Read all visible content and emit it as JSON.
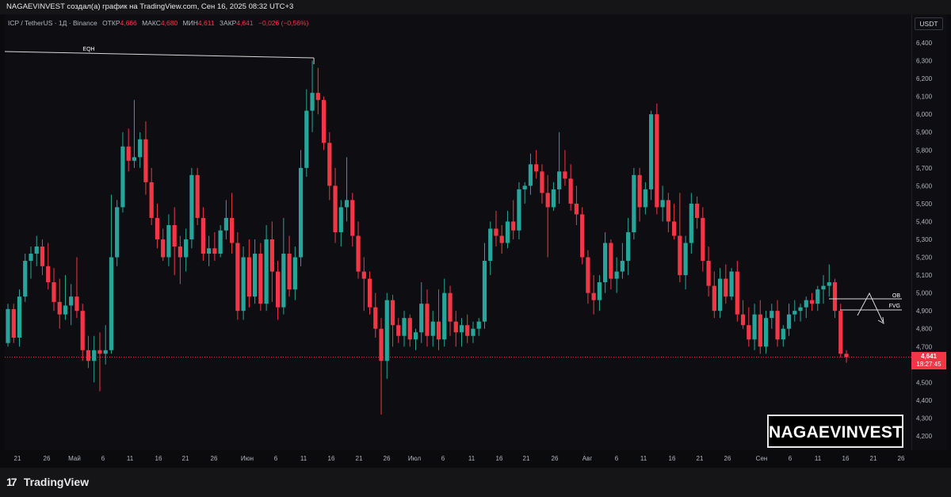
{
  "header": {
    "attribution": "NAGAEVINVEST создал(а) график на TradingView.com, Сен 16, 2025 08:32 UTC+3"
  },
  "legend": {
    "symbol": "ICP / TetherUS · 1Д · Binance",
    "open_label": "ОТКР",
    "open": "4,666",
    "high_label": "МАКС",
    "high": "4,680",
    "low_label": "МИН",
    "low": "4,611",
    "close_label": "ЗАКР",
    "close": "4,641",
    "change": "−0,026 (−0,56%)"
  },
  "currency": "USDT",
  "price_tag": {
    "price": "4,641",
    "countdown": "18:27:45"
  },
  "watermark": "NAGAEVINVEST",
  "footer": {
    "brand": "TradingView"
  },
  "colors": {
    "up": "#26a69a",
    "down": "#f23645",
    "background": "#0e0e12",
    "annotation": "#d8d8d8"
  },
  "chart_data": {
    "type": "candlestick",
    "ylim": [
      4.12,
      6.51
    ],
    "y_ticks": [
      "6,400",
      "6,300",
      "6,200",
      "6,100",
      "6,000",
      "5,900",
      "5,800",
      "5,700",
      "5,600",
      "5,500",
      "5,400",
      "5,300",
      "5,200",
      "5,100",
      "5,000",
      "4,900",
      "4,800",
      "4,700",
      "4,500",
      "4,400",
      "4,300",
      "4,200"
    ],
    "x_ticks": [
      "21",
      "26",
      "Май",
      "6",
      "11",
      "16",
      "21",
      "26",
      "Июн",
      "6",
      "11",
      "16",
      "21",
      "26",
      "Июл",
      "6",
      "11",
      "16",
      "21",
      "26",
      "Авг",
      "6",
      "11",
      "16",
      "21",
      "26",
      "Сен",
      "6",
      "11",
      "16",
      "21",
      "26"
    ],
    "candles_ohlc": [
      [
        4.72,
        4.94,
        4.7,
        4.91
      ],
      [
        4.91,
        4.94,
        4.72,
        4.75
      ],
      [
        4.75,
        5.02,
        4.7,
        4.98
      ],
      [
        4.98,
        5.22,
        4.95,
        5.18
      ],
      [
        5.18,
        5.26,
        5.08,
        5.22
      ],
      [
        5.22,
        5.32,
        5.15,
        5.26
      ],
      [
        5.26,
        5.3,
        5.1,
        5.15
      ],
      [
        5.15,
        5.28,
        5.02,
        5.06
      ],
      [
        5.06,
        5.14,
        4.9,
        4.95
      ],
      [
        4.95,
        5.08,
        4.8,
        4.88
      ],
      [
        4.88,
        5.1,
        4.85,
        4.93
      ],
      [
        4.93,
        5.05,
        4.82,
        4.98
      ],
      [
        4.98,
        5.2,
        4.86,
        4.9
      ],
      [
        4.9,
        4.94,
        4.62,
        4.68
      ],
      [
        4.68,
        4.76,
        4.58,
        4.62
      ],
      [
        4.62,
        4.76,
        4.5,
        4.68
      ],
      [
        4.68,
        4.78,
        4.45,
        4.66
      ],
      [
        4.66,
        4.82,
        4.6,
        4.68
      ],
      [
        4.68,
        5.55,
        4.66,
        5.2
      ],
      [
        5.2,
        5.52,
        5.15,
        5.48
      ],
      [
        5.48,
        5.9,
        5.45,
        5.82
      ],
      [
        5.82,
        5.92,
        5.68,
        5.74
      ],
      [
        5.74,
        6.08,
        5.7,
        5.76
      ],
      [
        5.76,
        5.9,
        5.7,
        5.86
      ],
      [
        5.86,
        5.96,
        5.55,
        5.62
      ],
      [
        5.62,
        5.7,
        5.38,
        5.42
      ],
      [
        5.42,
        5.5,
        5.25,
        5.3
      ],
      [
        5.3,
        5.36,
        5.18,
        5.2
      ],
      [
        5.2,
        5.44,
        5.15,
        5.38
      ],
      [
        5.38,
        5.48,
        5.1,
        5.26
      ],
      [
        5.26,
        5.32,
        5.05,
        5.2
      ],
      [
        5.2,
        5.36,
        5.12,
        5.3
      ],
      [
        5.3,
        5.7,
        5.25,
        5.66
      ],
      [
        5.66,
        5.7,
        5.38,
        5.42
      ],
      [
        5.42,
        5.48,
        5.18,
        5.22
      ],
      [
        5.22,
        5.32,
        5.15,
        5.25
      ],
      [
        5.25,
        5.34,
        5.18,
        5.22
      ],
      [
        5.22,
        5.38,
        5.2,
        5.35
      ],
      [
        5.35,
        5.52,
        5.3,
        5.42
      ],
      [
        5.42,
        5.56,
        5.22,
        5.28
      ],
      [
        5.28,
        5.34,
        4.85,
        4.9
      ],
      [
        4.9,
        5.26,
        4.85,
        5.2
      ],
      [
        5.2,
        5.3,
        4.92,
        4.98
      ],
      [
        4.98,
        5.3,
        4.94,
        5.22
      ],
      [
        5.22,
        5.28,
        4.9,
        4.94
      ],
      [
        4.94,
        5.38,
        4.9,
        5.3
      ],
      [
        5.3,
        5.4,
        4.95,
        5.12
      ],
      [
        5.12,
        5.18,
        4.85,
        4.92
      ],
      [
        4.92,
        5.42,
        4.88,
        5.22
      ],
      [
        5.22,
        5.32,
        4.98,
        5.02
      ],
      [
        5.02,
        5.26,
        4.96,
        5.2
      ],
      [
        5.2,
        5.8,
        5.15,
        5.7
      ],
      [
        5.7,
        6.14,
        5.65,
        6.02
      ],
      [
        6.02,
        6.3,
        5.9,
        6.12
      ],
      [
        6.12,
        6.26,
        6.0,
        6.08
      ],
      [
        6.08,
        6.1,
        5.8,
        5.84
      ],
      [
        5.84,
        5.9,
        5.52,
        5.6
      ],
      [
        5.6,
        5.7,
        5.28,
        5.34
      ],
      [
        5.34,
        5.52,
        5.26,
        5.48
      ],
      [
        5.48,
        5.76,
        5.4,
        5.52
      ],
      [
        5.52,
        5.56,
        5.26,
        5.32
      ],
      [
        5.32,
        5.4,
        5.08,
        5.12
      ],
      [
        5.12,
        5.2,
        4.9,
        5.08
      ],
      [
        5.08,
        5.12,
        4.88,
        4.92
      ],
      [
        4.92,
        5.0,
        4.75,
        4.8
      ],
      [
        4.8,
        4.86,
        4.32,
        4.62
      ],
      [
        4.62,
        5.0,
        4.52,
        4.96
      ],
      [
        4.96,
        4.99,
        4.7,
        4.82
      ],
      [
        4.82,
        4.86,
        4.72,
        4.76
      ],
      [
        4.76,
        4.9,
        4.7,
        4.86
      ],
      [
        4.86,
        4.88,
        4.7,
        4.74
      ],
      [
        4.74,
        4.8,
        4.68,
        4.78
      ],
      [
        4.78,
        5.06,
        4.72,
        4.94
      ],
      [
        4.94,
        5.02,
        4.7,
        4.76
      ],
      [
        4.76,
        4.9,
        4.7,
        4.84
      ],
      [
        4.84,
        5.02,
        4.68,
        4.74
      ],
      [
        4.74,
        5.08,
        4.7,
        5.0
      ],
      [
        5.0,
        5.04,
        4.76,
        4.84
      ],
      [
        4.84,
        4.9,
        4.7,
        4.78
      ],
      [
        4.78,
        4.86,
        4.7,
        4.82
      ],
      [
        4.82,
        4.88,
        4.72,
        4.76
      ],
      [
        4.76,
        4.84,
        4.72,
        4.8
      ],
      [
        4.8,
        4.86,
        4.76,
        4.84
      ],
      [
        4.84,
        5.28,
        4.8,
        5.18
      ],
      [
        5.18,
        5.4,
        5.1,
        5.36
      ],
      [
        5.36,
        5.46,
        5.26,
        5.32
      ],
      [
        5.32,
        5.38,
        5.22,
        5.28
      ],
      [
        5.28,
        5.46,
        5.25,
        5.4
      ],
      [
        5.4,
        5.52,
        5.3,
        5.35
      ],
      [
        5.35,
        5.62,
        5.3,
        5.58
      ],
      [
        5.58,
        5.62,
        5.5,
        5.6
      ],
      [
        5.6,
        5.78,
        5.55,
        5.72
      ],
      [
        5.72,
        5.8,
        5.64,
        5.68
      ],
      [
        5.68,
        5.72,
        5.5,
        5.56
      ],
      [
        5.56,
        5.66,
        5.2,
        5.48
      ],
      [
        5.48,
        5.62,
        5.46,
        5.58
      ],
      [
        5.58,
        5.9,
        5.5,
        5.68
      ],
      [
        5.68,
        5.8,
        5.6,
        5.64
      ],
      [
        5.64,
        5.72,
        5.46,
        5.5
      ],
      [
        5.5,
        5.6,
        5.38,
        5.44
      ],
      [
        5.44,
        5.48,
        5.16,
        5.2
      ],
      [
        5.2,
        5.24,
        4.94,
        5.0
      ],
      [
        5.0,
        5.1,
        4.88,
        4.96
      ],
      [
        4.96,
        5.1,
        4.9,
        5.06
      ],
      [
        5.06,
        5.34,
        5.0,
        5.28
      ],
      [
        5.28,
        5.3,
        5.02,
        5.08
      ],
      [
        5.08,
        5.2,
        5.0,
        5.12
      ],
      [
        5.12,
        5.28,
        5.08,
        5.18
      ],
      [
        5.18,
        5.42,
        5.1,
        5.34
      ],
      [
        5.34,
        5.7,
        5.3,
        5.66
      ],
      [
        5.66,
        5.7,
        5.4,
        5.48
      ],
      [
        5.48,
        5.62,
        5.44,
        5.58
      ],
      [
        5.58,
        6.02,
        5.52,
        6.0
      ],
      [
        6.0,
        6.06,
        5.44,
        5.48
      ],
      [
        5.48,
        5.6,
        5.4,
        5.52
      ],
      [
        5.52,
        5.56,
        5.34,
        5.4
      ],
      [
        5.4,
        5.5,
        5.3,
        5.32
      ],
      [
        5.32,
        5.56,
        5.06,
        5.1
      ],
      [
        5.1,
        5.32,
        5.02,
        5.28
      ],
      [
        5.28,
        5.56,
        5.22,
        5.5
      ],
      [
        5.5,
        5.54,
        5.36,
        5.42
      ],
      [
        5.42,
        5.48,
        5.12,
        5.18
      ],
      [
        5.18,
        5.26,
        4.98,
        5.04
      ],
      [
        5.04,
        5.12,
        4.86,
        4.9
      ],
      [
        4.9,
        5.14,
        4.86,
        5.08
      ],
      [
        5.08,
        5.16,
        4.94,
        4.98
      ],
      [
        4.98,
        5.14,
        4.96,
        5.12
      ],
      [
        5.12,
        5.18,
        4.84,
        4.88
      ],
      [
        4.88,
        4.96,
        4.8,
        4.82
      ],
      [
        4.82,
        4.92,
        4.7,
        4.74
      ],
      [
        4.74,
        4.94,
        4.68,
        4.88
      ],
      [
        4.88,
        4.96,
        4.66,
        4.7
      ],
      [
        4.7,
        4.9,
        4.66,
        4.86
      ],
      [
        4.86,
        4.94,
        4.8,
        4.9
      ],
      [
        4.9,
        4.96,
        4.7,
        4.74
      ],
      [
        4.74,
        4.82,
        4.7,
        4.8
      ],
      [
        4.8,
        4.94,
        4.76,
        4.88
      ],
      [
        4.88,
        4.96,
        4.84,
        4.9
      ],
      [
        4.9,
        4.94,
        4.84,
        4.92
      ],
      [
        4.92,
        4.98,
        4.86,
        4.96
      ],
      [
        4.96,
        5.0,
        4.9,
        4.94
      ],
      [
        4.94,
        5.04,
        4.9,
        5.02
      ],
      [
        5.02,
        5.1,
        4.94,
        5.04
      ],
      [
        5.04,
        5.16,
        4.98,
        5.06
      ],
      [
        5.06,
        5.08,
        4.86,
        4.9
      ],
      [
        4.9,
        4.94,
        4.64,
        4.66
      ],
      [
        4.66,
        4.68,
        4.61,
        4.641
      ]
    ],
    "annotations": {
      "eqh": "EQH",
      "ob": "OB",
      "fvg": "FVG"
    },
    "current_price": 4.641
  }
}
